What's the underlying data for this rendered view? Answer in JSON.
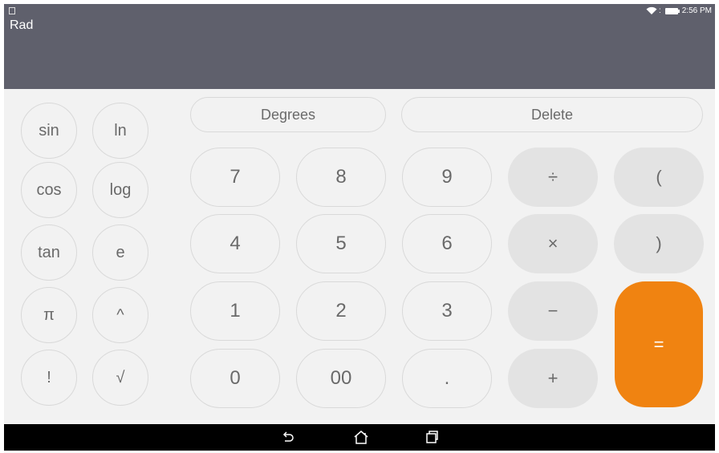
{
  "display": {
    "mode": "Rad"
  },
  "status_bar": {
    "colon": ":",
    "time": "2:56 PM",
    "icons": [
      "notification-icon",
      "wifi-icon",
      "battery-icon"
    ]
  },
  "top_row": {
    "angle_mode": "Degrees",
    "delete": "Delete"
  },
  "scientific": {
    "sin": "sin",
    "ln": "ln",
    "cos": "cos",
    "log": "log",
    "tan": "tan",
    "e": "e",
    "pi": "π",
    "power": "^",
    "factorial": "!",
    "sqrt": "√"
  },
  "digits": {
    "d7": "7",
    "d8": "8",
    "d9": "9",
    "d4": "4",
    "d5": "5",
    "d6": "6",
    "d1": "1",
    "d2": "2",
    "d3": "3",
    "d0": "0",
    "d00": "00",
    "dot": "."
  },
  "operators": {
    "divide": "÷",
    "multiply": "×",
    "minus": "−",
    "plus": "+",
    "open_paren": "(",
    "close_paren": ")",
    "equals": "="
  },
  "navigation": {
    "icons": [
      "back-icon",
      "home-icon",
      "recent-apps-icon"
    ]
  },
  "colors": {
    "display_bg": "#5f606c",
    "keypad_bg": "#f2f2f2",
    "operator_bg": "#e3e3e3",
    "equals_bg": "#f08311"
  }
}
